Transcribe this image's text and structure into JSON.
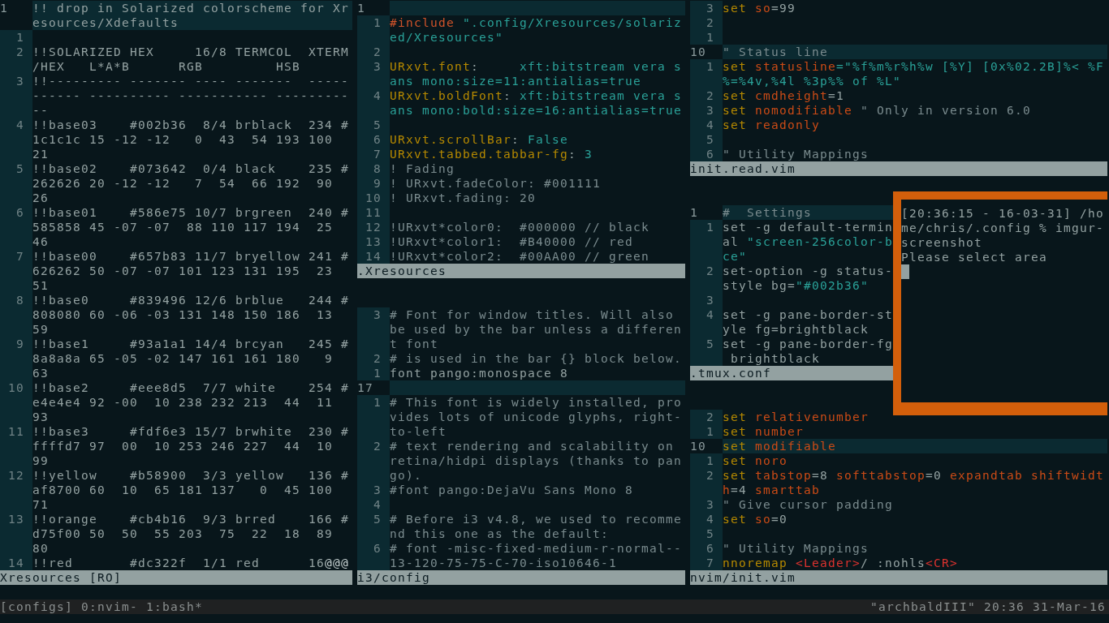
{
  "columns": [
    {
      "panes": [
        {
          "file": "Xresources [RO]",
          "lines": [
            {
              "n": "1",
              "current": true,
              "text": "!! drop in Solarized colorscheme for Xresources/Xdefaults"
            },
            {
              "n": "1",
              "current": false
            },
            {
              "n": "2",
              "current": false,
              "text": "!!SOLARIZED HEX     16/8 TERMCOL  XTERM/HEX   L*A*B      RGB         HSB"
            },
            {
              "n": "3",
              "current": false,
              "text": "!!--------- ------- ---- -------  ----------- ---------- ----------- -----------"
            },
            {
              "n": "4",
              "current": false,
              "text": "!!base03    #002b36  8/4 brblack  234 #1c1c1c 15 -12 -12   0  43  54 193 100  21"
            },
            {
              "n": "5",
              "current": false,
              "text": "!!base02    #073642  0/4 black    235 #262626 20 -12 -12   7  54  66 192  90  26"
            },
            {
              "n": "6",
              "current": false,
              "text": "!!base01    #586e75 10/7 brgreen  240 #585858 45 -07 -07  88 110 117 194  25  46"
            },
            {
              "n": "7",
              "current": false,
              "text": "!!base00    #657b83 11/7 bryellow 241 #626262 50 -07 -07 101 123 131 195  23  51"
            },
            {
              "n": "8",
              "current": false,
              "text": "!!base0     #839496 12/6 brblue   244 #808080 60 -06 -03 131 148 150 186  13  59"
            },
            {
              "n": "9",
              "current": false,
              "text": "!!base1     #93a1a1 14/4 brcyan   245 #8a8a8a 65 -05 -02 147 161 161 180   9  63"
            },
            {
              "n": "10",
              "current": false,
              "text": "!!base2     #eee8d5  7/7 white    254 #e4e4e4 92 -00  10 238 232 213  44  11  93"
            },
            {
              "n": "11",
              "current": false,
              "text": "!!base3     #fdf6e3 15/7 brwhite  230 #ffffd7 97  00  10 253 246 227  44  10  99"
            },
            {
              "n": "12",
              "current": false,
              "text": "!!yellow    #b58900  3/3 yellow   136 #af8700 60  10  65 181 137   0  45 100  71"
            },
            {
              "n": "13",
              "current": false,
              "text": "!!orange    #cb4b16  9/3 brred    166 #d75f00 50  50  55 203  75  22  18  89  80"
            },
            {
              "n": "14",
              "current": false,
              "segments": [
                {
                  "kind": "plain",
                  "text": "!!red       #dc322f  1/1 red      16"
                },
                {
                  "kind": "nontext",
                  "text": "@@@"
                }
              ]
            }
          ]
        }
      ]
    },
    {
      "panes": [
        {
          "file": ".Xresources",
          "lines": [
            {
              "n": "1",
              "current": true
            },
            {
              "n": "1",
              "current": false,
              "segments": [
                {
                  "kind": "preproc",
                  "text": "#include"
                },
                {
                  "kind": "string",
                  "text": " \".config/Xresources/solarized/Xresources\""
                }
              ]
            },
            {
              "n": "2",
              "current": false
            },
            {
              "n": "3",
              "current": false,
              "segments": [
                {
                  "kind": "keyword",
                  "text": "URxvt.font"
                },
                {
                  "kind": "plain",
                  "text": ":     "
                },
                {
                  "kind": "string",
                  "text": "xft:bitstream vera sans mono:size=11:antialias=true"
                }
              ]
            },
            {
              "n": "4",
              "current": false,
              "segments": [
                {
                  "kind": "keyword",
                  "text": "URxvt.boldFont"
                },
                {
                  "kind": "plain",
                  "text": ": "
                },
                {
                  "kind": "string",
                  "text": "xft:bitstream vera sans mono:bold:size=16:antialias=true"
                }
              ]
            },
            {
              "n": "5",
              "current": false
            },
            {
              "n": "6",
              "current": false,
              "segments": [
                {
                  "kind": "keyword",
                  "text": "URxvt.scrollBar"
                },
                {
                  "kind": "plain",
                  "text": ": "
                },
                {
                  "kind": "string",
                  "text": "False"
                }
              ]
            },
            {
              "n": "7",
              "current": false,
              "segments": [
                {
                  "kind": "keyword",
                  "text": "URxvt.tabbed.tabbar-fg"
                },
                {
                  "kind": "plain",
                  "text": ": "
                },
                {
                  "kind": "string",
                  "text": "3"
                }
              ]
            },
            {
              "n": "8",
              "current": false,
              "segments": [
                {
                  "kind": "comment",
                  "text": "! Fading"
                }
              ]
            },
            {
              "n": "9",
              "current": false,
              "segments": [
                {
                  "kind": "comment",
                  "text": "! URxvt.fadeColor: #001111"
                }
              ]
            },
            {
              "n": "10",
              "current": false,
              "segments": [
                {
                  "kind": "comment",
                  "text": "! URxvt.fading: 20"
                }
              ]
            },
            {
              "n": "11",
              "current": false
            },
            {
              "n": "12",
              "current": false,
              "segments": [
                {
                  "kind": "comment",
                  "text": "!URxvt*color0:  #000000 // black"
                }
              ]
            },
            {
              "n": "13",
              "current": false,
              "segments": [
                {
                  "kind": "comment",
                  "text": "!URxvt*color1:  #B40000 // red"
                }
              ]
            },
            {
              "n": "14",
              "current": false,
              "segments": [
                {
                  "kind": "comment",
                  "text": "!URxvt*color2:  #00AA00 // green"
                }
              ]
            }
          ]
        },
        {
          "file": "i3/config",
          "lines": [
            {
              "n": "3",
              "current": false,
              "segments": [
                {
                  "kind": "comment",
                  "text": "# Font for window titles. Will also be used by the bar unless a different font"
                }
              ]
            },
            {
              "n": "2",
              "current": false,
              "segments": [
                {
                  "kind": "comment",
                  "text": "# is used in the bar {} block below."
                }
              ]
            },
            {
              "n": "1",
              "current": false,
              "text": "font pango:monospace 8"
            },
            {
              "n": "17",
              "current": true
            },
            {
              "n": "1",
              "current": false,
              "segments": [
                {
                  "kind": "comment",
                  "text": "# This font is widely installed, provides lots of unicode glyphs, right-to-left"
                }
              ]
            },
            {
              "n": "2",
              "current": false,
              "segments": [
                {
                  "kind": "comment",
                  "text": "# text rendering and scalability on retina/hidpi displays (thanks to pango)."
                }
              ]
            },
            {
              "n": "3",
              "current": false,
              "segments": [
                {
                  "kind": "comment",
                  "text": "#font pango:DejaVu Sans Mono 8"
                }
              ]
            },
            {
              "n": "4",
              "current": false
            },
            {
              "n": "5",
              "current": false,
              "segments": [
                {
                  "kind": "comment",
                  "text": "# Before i3 v4.8, we used to recommend this one as the default:"
                }
              ]
            },
            {
              "n": "6",
              "current": false,
              "segments": [
                {
                  "kind": "comment",
                  "text": "# font -misc-fixed-medium-r-normal--13-120-75-75-C-70-iso10646-1"
                }
              ]
            }
          ]
        }
      ]
    },
    {
      "panes": [
        {
          "file": "init.read.vim",
          "lines": [
            {
              "n": "3",
              "current": false,
              "segments": [
                {
                  "kind": "keyword",
                  "text": "set"
                },
                {
                  "kind": "option",
                  "text": " so"
                },
                {
                  "kind": "plain",
                  "text": "=99"
                }
              ]
            },
            {
              "n": "2",
              "current": false
            },
            {
              "n": "1",
              "current": false
            },
            {
              "n": "10",
              "current": true,
              "segments": [
                {
                  "kind": "comment",
                  "text": "\" Status line"
                }
              ]
            },
            {
              "n": "1",
              "current": false,
              "segments": [
                {
                  "kind": "keyword",
                  "text": "set"
                },
                {
                  "kind": "option",
                  "text": " statusline"
                },
                {
                  "kind": "string",
                  "text": "=\"%f%m%r%h%w [%Y] [0x%02.2B]%< %F%=%4v,%4l %3p%% of %L\""
                }
              ]
            },
            {
              "n": "2",
              "current": false,
              "segments": [
                {
                  "kind": "keyword",
                  "text": "set"
                },
                {
                  "kind": "option",
                  "text": " cmdheight"
                },
                {
                  "kind": "plain",
                  "text": "=1"
                }
              ]
            },
            {
              "n": "3",
              "current": false,
              "segments": [
                {
                  "kind": "keyword",
                  "text": "set"
                },
                {
                  "kind": "option",
                  "text": " nomodifiable"
                },
                {
                  "kind": "comment",
                  "text": " \" Only in version 6.0"
                }
              ]
            },
            {
              "n": "4",
              "current": false,
              "segments": [
                {
                  "kind": "keyword",
                  "text": "set"
                },
                {
                  "kind": "option",
                  "text": " readonly"
                }
              ]
            },
            {
              "n": "5",
              "current": false
            },
            {
              "n": "6",
              "current": false,
              "segments": [
                {
                  "kind": "comment",
                  "text": "\" Utility Mappings"
                }
              ]
            }
          ]
        },
        {
          "file": ".tmux.conf",
          "lines": [
            {
              "n": "1",
              "current": true,
              "segments": [
                {
                  "kind": "comment",
                  "text": "#  Settings"
                }
              ]
            },
            {
              "n": "1",
              "current": false,
              "segments": [
                {
                  "kind": "plain",
                  "text": "set -g default-terminal "
                },
                {
                  "kind": "string",
                  "text": "\"screen-256color-bce\""
                }
              ]
            },
            {
              "n": "2",
              "current": false,
              "segments": [
                {
                  "kind": "plain",
                  "text": "set-option -g status-style bg="
                },
                {
                  "kind": "string",
                  "text": "\"#002b36\""
                }
              ]
            },
            {
              "n": "3",
              "current": false
            },
            {
              "n": "4",
              "current": false,
              "text": "set -g pane-border-style fg=brightblack"
            },
            {
              "n": "5",
              "current": false,
              "text": "set -g pane-border-fg brightblack"
            }
          ]
        },
        {
          "file": "nvim/init.vim",
          "lines": [
            {
              "n": "2",
              "current": false,
              "segments": [
                {
                  "kind": "keyword",
                  "text": "set"
                },
                {
                  "kind": "option",
                  "text": " relativenumber"
                }
              ]
            },
            {
              "n": "1",
              "current": false,
              "segments": [
                {
                  "kind": "keyword",
                  "text": "set"
                },
                {
                  "kind": "option",
                  "text": " number"
                }
              ]
            },
            {
              "n": "10",
              "current": true,
              "segments": [
                {
                  "kind": "keyword",
                  "text": "set"
                },
                {
                  "kind": "option",
                  "text": " modifiable"
                }
              ]
            },
            {
              "n": "1",
              "current": false,
              "segments": [
                {
                  "kind": "keyword",
                  "text": "set"
                },
                {
                  "kind": "option",
                  "text": " noro"
                }
              ]
            },
            {
              "n": "2",
              "current": false,
              "segments": [
                {
                  "kind": "keyword",
                  "text": "set"
                },
                {
                  "kind": "option",
                  "text": " tabstop"
                },
                {
                  "kind": "plain",
                  "text": "=8 "
                },
                {
                  "kind": "option",
                  "text": "softtabstop"
                },
                {
                  "kind": "plain",
                  "text": "=0 "
                },
                {
                  "kind": "option",
                  "text": "expandtab shiftwidth"
                },
                {
                  "kind": "plain",
                  "text": "=4 "
                },
                {
                  "kind": "option",
                  "text": "smarttab"
                }
              ]
            },
            {
              "n": "3",
              "current": false,
              "segments": [
                {
                  "kind": "comment",
                  "text": "\" Give cursor padding"
                }
              ]
            },
            {
              "n": "4",
              "current": false,
              "segments": [
                {
                  "kind": "keyword",
                  "text": "set"
                },
                {
                  "kind": "option",
                  "text": " so"
                },
                {
                  "kind": "plain",
                  "text": "=0"
                }
              ]
            },
            {
              "n": "5",
              "current": false
            },
            {
              "n": "6",
              "current": false,
              "segments": [
                {
                  "kind": "comment",
                  "text": "\" Utility Mappings"
                }
              ]
            },
            {
              "n": "7",
              "current": false,
              "segments": [
                {
                  "kind": "keyword",
                  "text": "nnoremap "
                },
                {
                  "kind": "special",
                  "text": "<Leader>"
                },
                {
                  "kind": "plain",
                  "text": "/ :nohls"
                },
                {
                  "kind": "special",
                  "text": "<CR>"
                }
              ]
            }
          ]
        }
      ]
    }
  ],
  "terminal": {
    "lines": [
      "[20:36:15 - 16-03-31] /home/chris/.config % imgur-screenshot",
      "Please select area"
    ]
  },
  "tmux_bar": {
    "session": "[configs]",
    "windows": [
      "0:nvim-",
      "1:bash*"
    ],
    "status": "\"archbaldIII\" 20:36 31-Mar-16"
  }
}
